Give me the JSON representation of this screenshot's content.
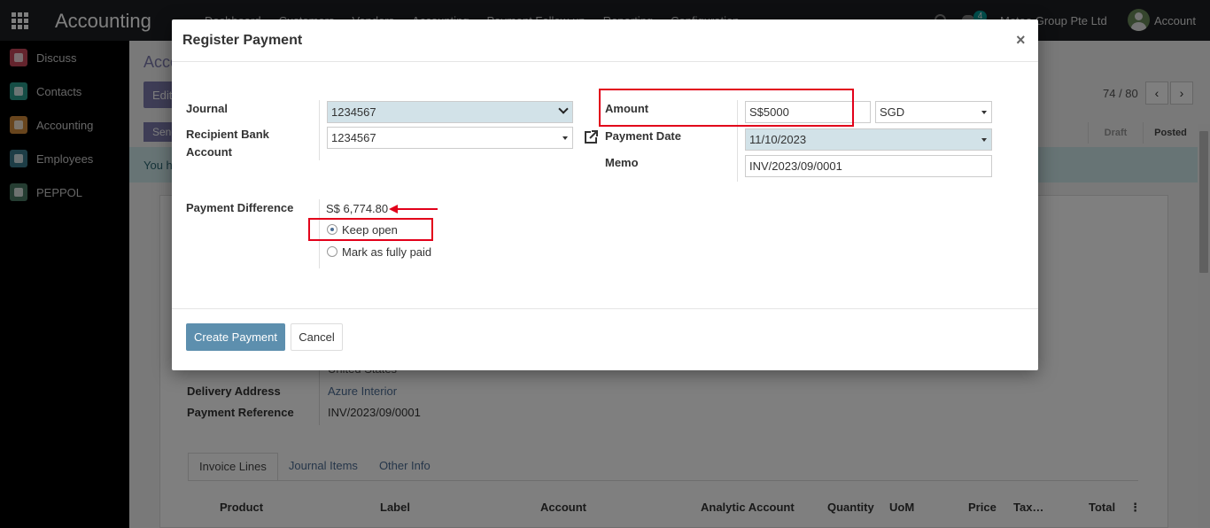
{
  "topbar": {
    "app_title": "Accounting",
    "menu": [
      "Dashboard",
      "Customers",
      "Vendors",
      "Accounting",
      "Payment Follow-up",
      "Reporting",
      "Configuration"
    ],
    "chat_count": "4",
    "company": "Meteo Group Pte Ltd",
    "account": "Account"
  },
  "sidebar": {
    "items": [
      {
        "label": "Discuss",
        "icon": "discuss-icon"
      },
      {
        "label": "Contacts",
        "icon": "contacts-icon"
      },
      {
        "label": "Accounting",
        "icon": "accounting-icon"
      },
      {
        "label": "Employees",
        "icon": "employees-icon"
      },
      {
        "label": "PEPPOL",
        "icon": "peppol-icon"
      }
    ]
  },
  "background": {
    "breadcrumb": "Acco",
    "edit_label": "Edit",
    "send_label": "Send",
    "pager": "74 / 80",
    "status_draft": "Draft",
    "status_posted": "Posted",
    "alert_text": "You h",
    "country": "United States",
    "delivery_address_label": "Delivery Address",
    "delivery_address_value": "Azure Interior",
    "payment_reference_label": "Payment Reference",
    "payment_reference_value": "INV/2023/09/0001",
    "tabs": [
      "Invoice Lines",
      "Journal Items",
      "Other Info"
    ],
    "table_headers": [
      "Product",
      "Label",
      "Account",
      "Analytic Account",
      "Quantity",
      "UoM",
      "Price",
      "Tax…",
      "Total"
    ]
  },
  "modal": {
    "title": "Register Payment",
    "close_symbol": "×",
    "journal_label": "Journal",
    "journal_value": "1234567",
    "recipient_bank_label": "Recipient Bank Account",
    "recipient_bank_value": "1234567",
    "amount_label": "Amount",
    "amount_value": "S$5000",
    "currency_value": "SGD",
    "payment_date_label": "Payment Date",
    "payment_date_value": "11/10/2023",
    "memo_label": "Memo",
    "memo_value": "INV/2023/09/0001",
    "payment_difference_label": "Payment Difference",
    "payment_difference_value": "S$ 6,774.80",
    "option_keep_open": "Keep open",
    "option_mark_paid": "Mark as fully paid",
    "create_payment_label": "Create Payment",
    "cancel_label": "Cancel"
  },
  "colors": {
    "annotation_red": "#e2001a",
    "primary_button": "#5d8fae",
    "required_field": "#d2e2e8"
  }
}
